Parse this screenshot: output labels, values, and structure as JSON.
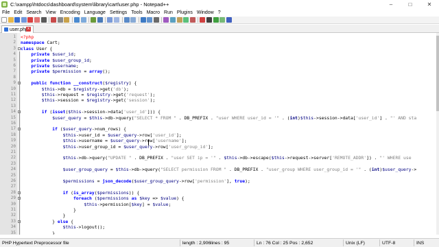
{
  "window": {
    "title": "C:\\xampp\\htdocs\\dashboard\\system\\library\\cart\\user.php - Notepad++",
    "minimize": "–",
    "maximize": "□",
    "close": "✕"
  },
  "menu": [
    "File",
    "Edit",
    "Search",
    "View",
    "Encoding",
    "Language",
    "Settings",
    "Tools",
    "Macro",
    "Run",
    "Plugins",
    "Window",
    "?"
  ],
  "tab": {
    "label": "user.php",
    "close": "x"
  },
  "colors": {
    "keyword": "#0000ff",
    "variable": "#000080",
    "string": "#808080",
    "php_tag": "#ff0000",
    "gutter": "#e4e4e4"
  },
  "editor": {
    "lines": [
      {
        "n": "1",
        "tokens": [
          [
            "tag",
            "<?php"
          ]
        ]
      },
      {
        "n": "2",
        "tokens": [
          [
            "kw",
            "namespace"
          ],
          [
            "op",
            " Cart;"
          ]
        ]
      },
      {
        "n": "3",
        "tokens": [
          [
            "kw",
            "class"
          ],
          [
            "op",
            " User {"
          ]
        ]
      },
      {
        "n": "4",
        "tokens": [
          [
            "op",
            "    "
          ],
          [
            "kw",
            "private"
          ],
          [
            "var",
            " $user_id"
          ],
          [
            "op",
            ";"
          ]
        ]
      },
      {
        "n": "5",
        "tokens": [
          [
            "op",
            "    "
          ],
          [
            "kw",
            "private"
          ],
          [
            "var",
            " $user_group_id"
          ],
          [
            "op",
            ";"
          ]
        ]
      },
      {
        "n": "6",
        "tokens": [
          [
            "op",
            "    "
          ],
          [
            "kw",
            "private"
          ],
          [
            "var",
            " $username"
          ],
          [
            "op",
            ";"
          ]
        ]
      },
      {
        "n": "7",
        "tokens": [
          [
            "op",
            "    "
          ],
          [
            "kw",
            "private"
          ],
          [
            "var",
            " $permission"
          ],
          [
            "op",
            " = "
          ],
          [
            "kw",
            "array"
          ],
          [
            "op",
            "();"
          ]
        ]
      },
      {
        "n": "8",
        "tokens": []
      },
      {
        "n": "9",
        "tokens": [
          [
            "op",
            "    "
          ],
          [
            "kw",
            "public function"
          ],
          [
            "op",
            " "
          ],
          [
            "kw",
            "__construct"
          ],
          [
            "op",
            "("
          ],
          [
            "var",
            "$registry"
          ],
          [
            "op",
            ") {"
          ]
        ]
      },
      {
        "n": "10",
        "tokens": [
          [
            "op",
            "        "
          ],
          [
            "var",
            "$this"
          ],
          [
            "op",
            "->db = "
          ],
          [
            "var",
            "$registry"
          ],
          [
            "op",
            "->get("
          ],
          [
            "str",
            "'db'"
          ],
          [
            "op",
            ");"
          ]
        ]
      },
      {
        "n": "11",
        "tokens": [
          [
            "op",
            "        "
          ],
          [
            "var",
            "$this"
          ],
          [
            "op",
            "->request = "
          ],
          [
            "var",
            "$registry"
          ],
          [
            "op",
            "->get("
          ],
          [
            "str",
            "'request'"
          ],
          [
            "op",
            ");"
          ]
        ]
      },
      {
        "n": "12",
        "tokens": [
          [
            "op",
            "        "
          ],
          [
            "var",
            "$this"
          ],
          [
            "op",
            "->session = "
          ],
          [
            "var",
            "$registry"
          ],
          [
            "op",
            "->get("
          ],
          [
            "str",
            "'session'"
          ],
          [
            "op",
            ");"
          ]
        ]
      },
      {
        "n": "13",
        "tokens": []
      },
      {
        "n": "14",
        "tokens": [
          [
            "op",
            "        "
          ],
          [
            "kw",
            "if"
          ],
          [
            "op",
            " ("
          ],
          [
            "kw",
            "isset"
          ],
          [
            "op",
            "("
          ],
          [
            "var",
            "$this"
          ],
          [
            "op",
            "->session->data["
          ],
          [
            "str",
            "'user_id'"
          ],
          [
            "op",
            "])) {"
          ]
        ]
      },
      {
        "n": "15",
        "tokens": [
          [
            "op",
            "            "
          ],
          [
            "var",
            "$user_query"
          ],
          [
            "op",
            " = "
          ],
          [
            "var",
            "$this"
          ],
          [
            "op",
            "->db->query("
          ],
          [
            "str",
            "\"SELECT * FROM \""
          ],
          [
            "op",
            " . DB_PREFIX . "
          ],
          [
            "str",
            "\"user WHERE user_id = '\""
          ],
          [
            "op",
            " . ("
          ],
          [
            "cast",
            "int"
          ],
          [
            "op",
            ")"
          ],
          [
            "var",
            "$this"
          ],
          [
            "op",
            "->session->data["
          ],
          [
            "str",
            "'user_id'"
          ],
          [
            "op",
            "] . "
          ],
          [
            "str",
            "\"' AND sta"
          ]
        ]
      },
      {
        "n": "16",
        "tokens": []
      },
      {
        "n": "17",
        "tokens": [
          [
            "op",
            "            "
          ],
          [
            "kw",
            "if"
          ],
          [
            "op",
            " ("
          ],
          [
            "var",
            "$user_query"
          ],
          [
            "op",
            "->num_rows) {"
          ]
        ]
      },
      {
        "n": "18",
        "tokens": [
          [
            "op",
            "                "
          ],
          [
            "var",
            "$this"
          ],
          [
            "op",
            "->user_id = "
          ],
          [
            "var",
            "$user_query"
          ],
          [
            "op",
            "->row["
          ],
          [
            "str",
            "'user_id'"
          ],
          [
            "op",
            "];"
          ]
        ]
      },
      {
        "n": "19",
        "tokens": [
          [
            "op",
            "                "
          ],
          [
            "var",
            "$this"
          ],
          [
            "op",
            "->username = "
          ],
          [
            "var",
            "$user_query"
          ],
          [
            "op",
            "->row["
          ],
          [
            "str",
            "'username'"
          ],
          [
            "op",
            "];"
          ]
        ]
      },
      {
        "n": "20",
        "tokens": [
          [
            "op",
            "                "
          ],
          [
            "var",
            "$this"
          ],
          [
            "op",
            "->user_group_id = "
          ],
          [
            "var",
            "$user_query"
          ],
          [
            "op",
            "->row["
          ],
          [
            "str",
            "'user_group_id'"
          ],
          [
            "op",
            "];"
          ]
        ]
      },
      {
        "n": "21",
        "tokens": []
      },
      {
        "n": "22",
        "tokens": [
          [
            "op",
            "                "
          ],
          [
            "var",
            "$this"
          ],
          [
            "op",
            "->db->query("
          ],
          [
            "str",
            "\"UPDATE \""
          ],
          [
            "op",
            " . DB_PREFIX . "
          ],
          [
            "str",
            "\"user SET ip = '\""
          ],
          [
            "op",
            " . "
          ],
          [
            "var",
            "$this"
          ],
          [
            "op",
            "->db->escape("
          ],
          [
            "var",
            "$this"
          ],
          [
            "op",
            "->request->server["
          ],
          [
            "str",
            "'REMOTE_ADDR'"
          ],
          [
            "op",
            "]) . "
          ],
          [
            "str",
            "\"' WHERE use"
          ]
        ]
      },
      {
        "n": "23",
        "tokens": []
      },
      {
        "n": "24",
        "tokens": [
          [
            "op",
            "                "
          ],
          [
            "var",
            "$user_group_query"
          ],
          [
            "op",
            " = "
          ],
          [
            "var",
            "$this"
          ],
          [
            "op",
            "->db->query("
          ],
          [
            "str",
            "\"SELECT permission FROM \""
          ],
          [
            "op",
            " . DB_PREFIX . "
          ],
          [
            "str",
            "\"user_group WHERE user_group_id = '\""
          ],
          [
            "op",
            " . ("
          ],
          [
            "cast",
            "int"
          ],
          [
            "op",
            ")"
          ],
          [
            "var",
            "$user_query"
          ],
          [
            "op",
            "->"
          ]
        ]
      },
      {
        "n": "25",
        "tokens": []
      },
      {
        "n": "26",
        "tokens": [
          [
            "op",
            "                "
          ],
          [
            "var",
            "$permissions"
          ],
          [
            "op",
            " = "
          ],
          [
            "kw",
            "json_decode"
          ],
          [
            "op",
            "("
          ],
          [
            "var",
            "$user_group_query"
          ],
          [
            "op",
            "->row["
          ],
          [
            "str",
            "'permission'"
          ],
          [
            "op",
            "], "
          ],
          [
            "kw",
            "true"
          ],
          [
            "op",
            ");"
          ]
        ]
      },
      {
        "n": "27",
        "tokens": []
      },
      {
        "n": "28",
        "tokens": [
          [
            "op",
            "                "
          ],
          [
            "kw",
            "if"
          ],
          [
            "op",
            " ("
          ],
          [
            "kw",
            "is_array"
          ],
          [
            "op",
            "("
          ],
          [
            "var",
            "$permissions"
          ],
          [
            "op",
            ")) {"
          ]
        ]
      },
      {
        "n": "29",
        "tokens": [
          [
            "op",
            "                    "
          ],
          [
            "kw",
            "foreach"
          ],
          [
            "op",
            " ("
          ],
          [
            "var",
            "$permissions"
          ],
          [
            "op",
            " "
          ],
          [
            "kw",
            "as"
          ],
          [
            "op",
            " "
          ],
          [
            "var",
            "$key"
          ],
          [
            "op",
            " => "
          ],
          [
            "var",
            "$value"
          ],
          [
            "op",
            ") {"
          ]
        ]
      },
      {
        "n": "30",
        "tokens": [
          [
            "op",
            "                        "
          ],
          [
            "var",
            "$this"
          ],
          [
            "op",
            "->permission["
          ],
          [
            "var",
            "$key"
          ],
          [
            "op",
            "] = "
          ],
          [
            "var",
            "$value"
          ],
          [
            "op",
            ";"
          ]
        ]
      },
      {
        "n": "31",
        "tokens": [
          [
            "op",
            "                    }"
          ]
        ]
      },
      {
        "n": "32",
        "tokens": [
          [
            "op",
            "                }"
          ]
        ]
      },
      {
        "n": "33",
        "tokens": [
          [
            "op",
            "            } "
          ],
          [
            "kw",
            "else"
          ],
          [
            "op",
            " {"
          ]
        ]
      },
      {
        "n": "34",
        "tokens": [
          [
            "op",
            "                "
          ],
          [
            "var",
            "$this"
          ],
          [
            "op",
            "->logout();"
          ]
        ]
      },
      {
        "n": "35",
        "tokens": [
          [
            "op",
            "            }"
          ]
        ]
      },
      {
        "n": "36",
        "tokens": [
          [
            "op",
            "        }"
          ]
        ]
      }
    ]
  },
  "status": {
    "language": "PHP Hypertext Preprocessor file",
    "length": "length : 2,906",
    "lines": "lines : 95",
    "position": "Ln : 76    Col : 25    Pos : 2,652",
    "eol": "Unix (LF)",
    "encoding": "UTF-8",
    "mode": "INS"
  }
}
